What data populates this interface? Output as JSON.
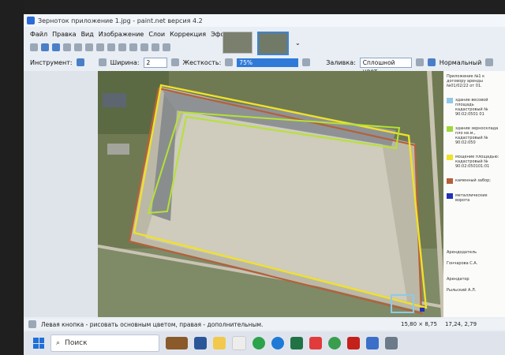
{
  "window": {
    "title": "Зерноток приложение 1.jpg - paint.net версия 4.2"
  },
  "menu": {
    "items": [
      "Файл",
      "Правка",
      "Вид",
      "Изображение",
      "Слои",
      "Коррекция",
      "Эффекты"
    ]
  },
  "toolbar": {
    "tool_label": "Инструмент:",
    "width_label": "Ширина:",
    "width_value": "2",
    "hardness_label": "Жесткость:",
    "hardness_value": "75%",
    "fill_label": "Заливка:",
    "fill_value": "Сплошной цвет",
    "blend_value": "Нормальный",
    "hardness_fraction": 0.75
  },
  "legend": {
    "header": "Приложение №1 к договору аренды №01/02/22 от 01.",
    "items": [
      {
        "color": "#8fc9e6",
        "text": "здание весовой площадь кадастровый № 90:02:0501 01"
      },
      {
        "color": "#9fd83a",
        "text": "здание зерносклада пло кв.м., кадастровый № 90:02:050"
      },
      {
        "color": "#f0e12a",
        "text": "мощение площадью: кадастровый № 90:02:050101:01"
      },
      {
        "color": "#b5603a",
        "text": "каменный забор;"
      },
      {
        "color": "#2232b8",
        "text": "металлические ворота"
      }
    ],
    "lessor_label": "Арендодатель",
    "lessor_name": "Гончарова С.А.",
    "tenant_label": "Арендатор",
    "tenant_name": "Рыльский А.Л."
  },
  "status": {
    "hint": "Левая кнопка - рисовать основным цветом, правая - дополнительным.",
    "selection_size": "15,80 × 8,75",
    "cursor_pos": "17,24, 2,79"
  },
  "taskbar": {
    "search_placeholder": "Поиск"
  },
  "colors": {
    "yellow_outline": "#f0e12a",
    "green_outline": "#b4e332",
    "brown_outline": "#b5603a",
    "blue_outline": "#8fc9e6",
    "accent": "#2f7ad8"
  }
}
